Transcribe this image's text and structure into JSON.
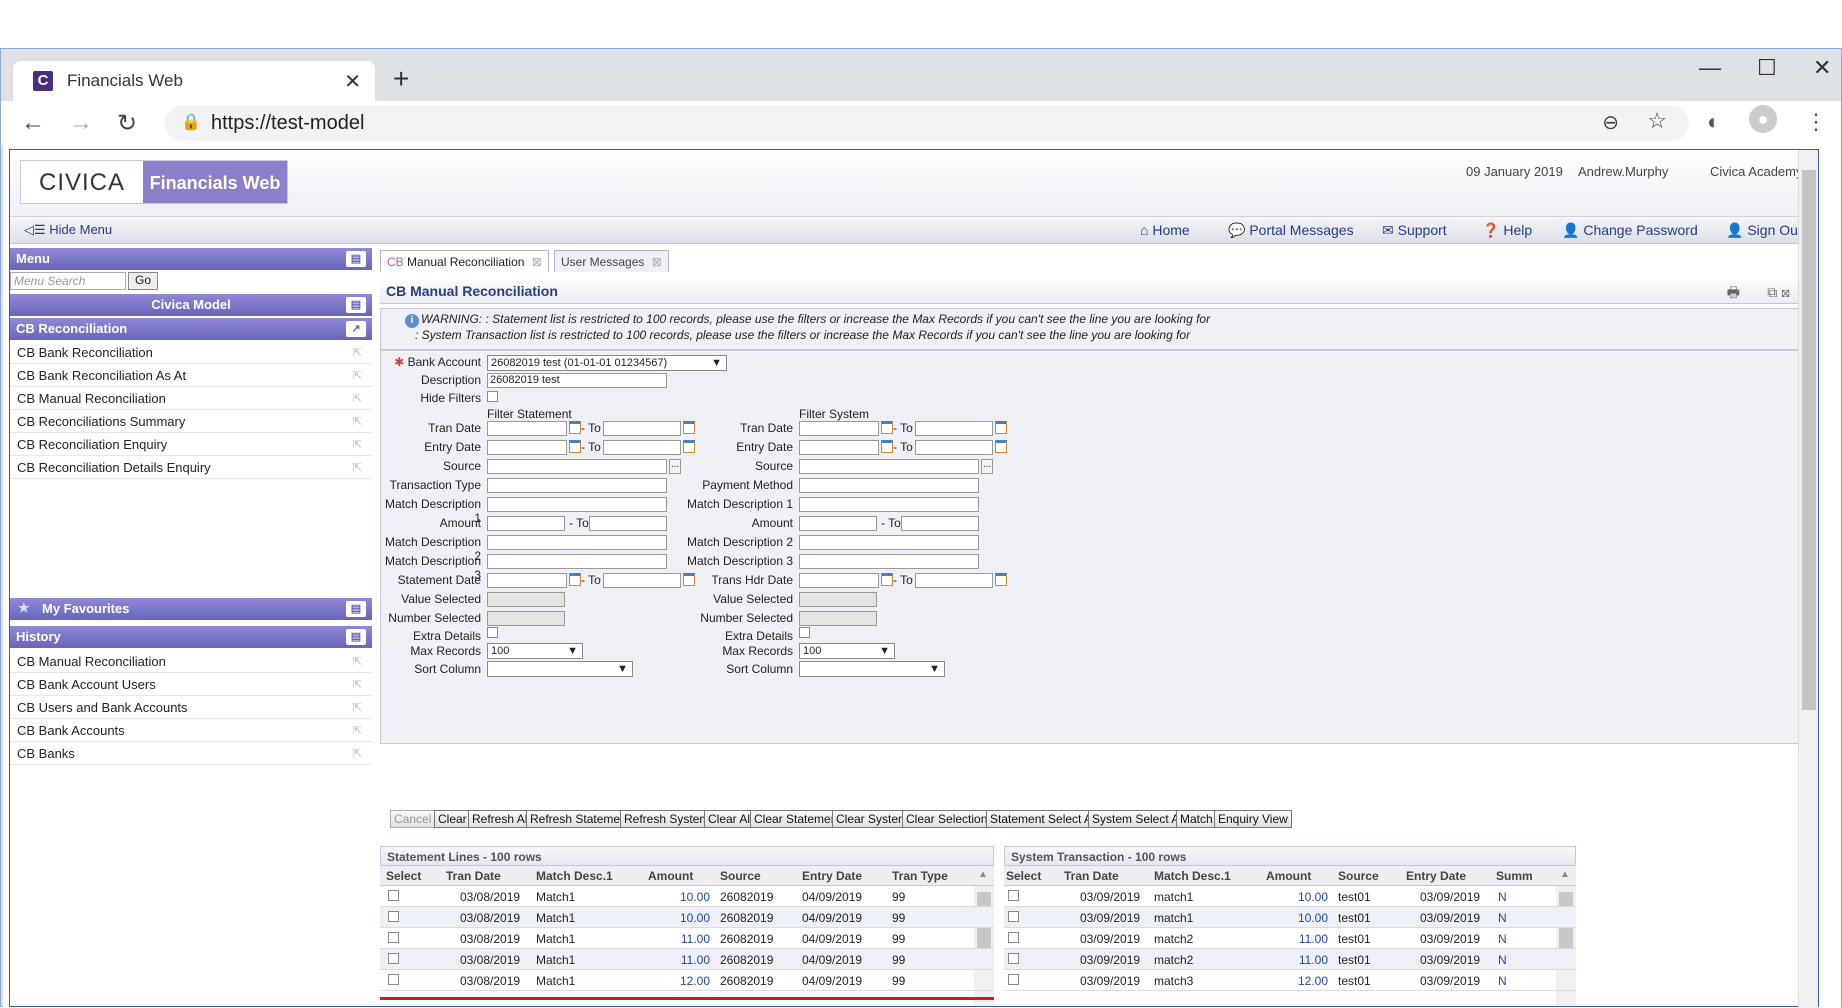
{
  "browser": {
    "tab_title": "Financials Web",
    "tab_close": "✕",
    "new_tab": "+",
    "url": "https://test-model",
    "window_controls": {
      "minimize": "—",
      "maximize": "☐",
      "close": "✕"
    }
  },
  "header": {
    "logo_civica": "CIVICA",
    "logo_product": "Financials Web",
    "date": "09 January 2019",
    "user": "Andrew.Murphy",
    "org": "Civica Academy"
  },
  "toplinks": {
    "hide_menu": "Hide Menu",
    "home": "Home",
    "portal_messages": "Portal Messages",
    "support": "Support",
    "help": "Help",
    "change_password": "Change Password",
    "sign_out": "Sign Out"
  },
  "sidebar": {
    "menu_title": "Menu",
    "menu_search_placeholder": "Menu Search",
    "go": "Go",
    "model_title": "Civica Model",
    "section_title": "CB Reconciliation",
    "items": [
      "CB Bank Reconciliation",
      "CB Bank Reconciliation As At",
      "CB Manual Reconciliation",
      "CB Reconciliations Summary",
      "CB Reconciliation Enquiry",
      "CB Reconciliation Details Enquiry"
    ],
    "favourites_title": "My Favourites",
    "history_title": "History",
    "history": [
      "CB Manual Reconciliation",
      "CB Bank Account Users",
      "CB Users and Bank Accounts",
      "CB Bank Accounts",
      "CB Banks"
    ]
  },
  "page_tabs": {
    "active_prefix": "CB",
    "active": "Manual Reconciliation",
    "other": "User Messages"
  },
  "page": {
    "title": "CB Manual Reconciliation",
    "warning_1": "WARNING: : Statement list is restricted to 100 records, please use the filters or increase the Max Records if you can't see the line you are looking for",
    "warning_2": ": System Transaction list is restricted to 100 records, please use the filters or increase the Max Records if you can't see the line you are looking for"
  },
  "form": {
    "bank_account_label": "Bank Account",
    "bank_account_value": "26082019 test (01-01-01 01234567)",
    "description_label": "Description",
    "description_value": "26082019 test",
    "hide_filters_label": "Hide Filters",
    "filter_statement": "Filter Statement",
    "filter_system": "Filter System",
    "to": "- To",
    "left_labels": {
      "tran_date": "Tran Date",
      "entry_date": "Entry Date",
      "source": "Source",
      "transaction_type": "Transaction Type",
      "match_desc_1": "Match Description 1",
      "amount": "Amount",
      "match_desc_2": "Match Description 2",
      "match_desc_3": "Match Description 3",
      "statement_date": "Statement Date",
      "value_selected": "Value Selected",
      "number_selected": "Number Selected",
      "extra_details": "Extra Details",
      "max_records": "Max Records",
      "sort_column": "Sort Column"
    },
    "right_labels": {
      "tran_date": "Tran Date",
      "entry_date": "Entry Date",
      "source": "Source",
      "payment_method": "Payment Method",
      "match_desc_1": "Match Description 1",
      "amount": "Amount",
      "match_desc_2": "Match Description 2",
      "match_desc_3": "Match Description 3",
      "trans_hdr_date": "Trans Hdr Date",
      "value_selected": "Value Selected",
      "number_selected": "Number Selected",
      "extra_details": "Extra Details",
      "max_records": "Max Records",
      "sort_column": "Sort Column"
    },
    "max_records_left": "100",
    "max_records_right": "100",
    "dots": "..."
  },
  "buttons": [
    "Cancel",
    "Clear",
    "Refresh All",
    "Refresh Statement",
    "Refresh System",
    "Clear All",
    "Clear Statement",
    "Clear System",
    "Clear Selections",
    "Statement Select All",
    "System Select All",
    "Match",
    "Enquiry View"
  ],
  "statement_grid": {
    "title": "Statement Lines - 100 rows",
    "columns": [
      "Select",
      "Tran Date",
      "Match Desc.1",
      "Amount",
      "Source",
      "Entry Date",
      "Tran Type"
    ],
    "rows": [
      [
        "03/08/2019",
        "Match1",
        "10.00",
        "26082019",
        "04/09/2019",
        "99"
      ],
      [
        "03/08/2019",
        "Match1",
        "10.00",
        "26082019",
        "04/09/2019",
        "99"
      ],
      [
        "03/08/2019",
        "Match1",
        "11.00",
        "26082019",
        "04/09/2019",
        "99"
      ],
      [
        "03/08/2019",
        "Match1",
        "11.00",
        "26082019",
        "04/09/2019",
        "99"
      ],
      [
        "03/08/2019",
        "Match1",
        "12.00",
        "26082019",
        "04/09/2019",
        "99"
      ]
    ]
  },
  "system_grid": {
    "title": "System Transaction - 100 rows",
    "columns": [
      "Select",
      "Tran Date",
      "Match Desc.1",
      "Amount",
      "Source",
      "Entry Date",
      "Summ"
    ],
    "rows": [
      [
        "03/09/2019",
        "match1",
        "10.00",
        "test01",
        "03/09/2019",
        "N"
      ],
      [
        "03/09/2019",
        "match1",
        "10.00",
        "test01",
        "03/09/2019",
        "N"
      ],
      [
        "03/09/2019",
        "match2",
        "11.00",
        "test01",
        "03/09/2019",
        "N"
      ],
      [
        "03/09/2019",
        "match2",
        "11.00",
        "test01",
        "03/09/2019",
        "N"
      ],
      [
        "03/09/2019",
        "match3",
        "12.00",
        "test01",
        "03/09/2019",
        "N"
      ]
    ]
  },
  "colors": {
    "accent": "#6a64bb",
    "link": "#2a3b85",
    "highlight": "#d8141c"
  }
}
